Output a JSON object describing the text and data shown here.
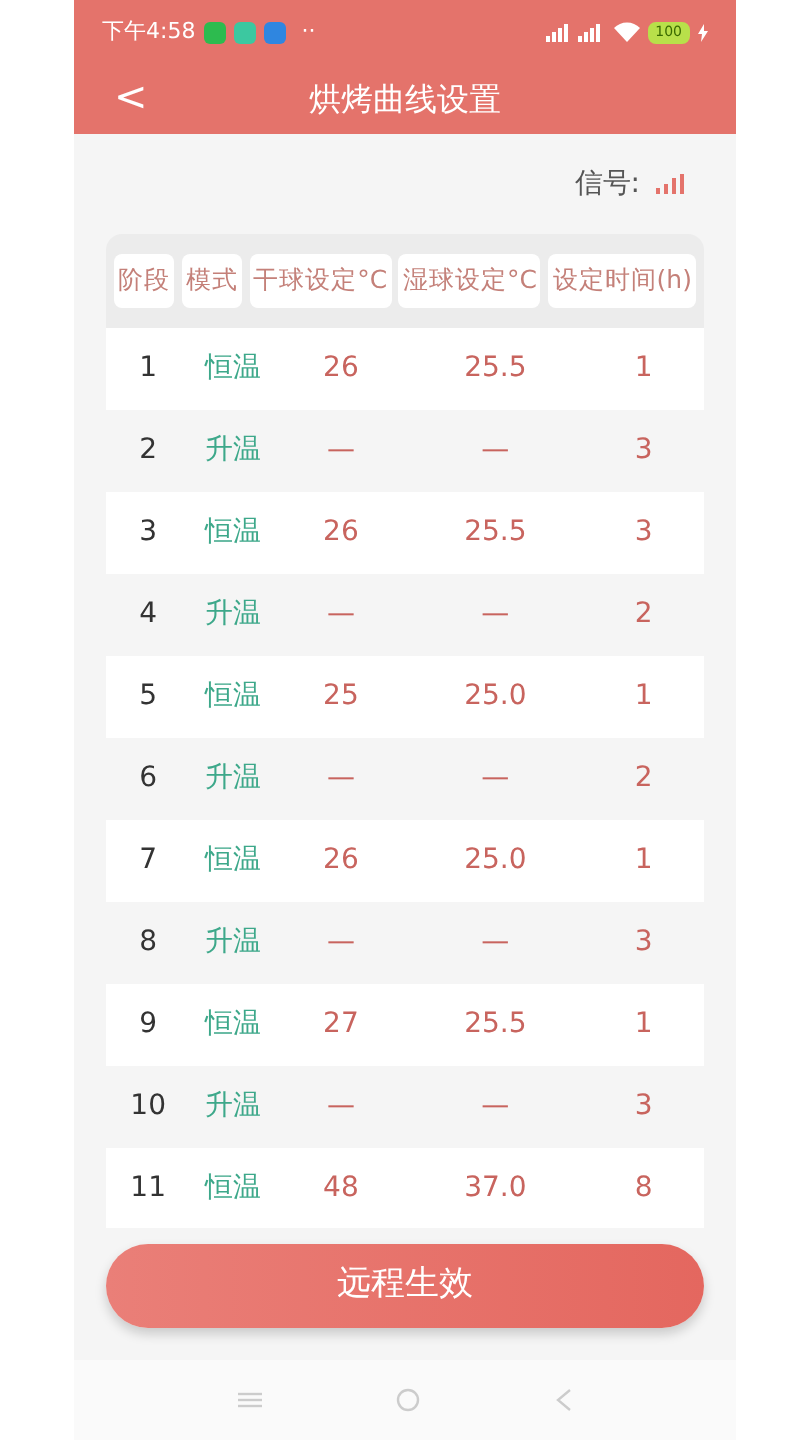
{
  "status_bar": {
    "time": "下午4:58",
    "more": "··",
    "battery": "100"
  },
  "header": {
    "back": "<",
    "title": "烘烤曲线设置"
  },
  "signal": {
    "label": "信号:"
  },
  "table": {
    "columns": [
      "阶段",
      "模式",
      "干球设定°C",
      "湿球设定°C",
      "设定时间(h)"
    ],
    "rows": [
      {
        "cells": [
          "1",
          "恒温",
          "26",
          "25.5",
          "1"
        ]
      },
      {
        "cells": [
          "2",
          "升温",
          "—",
          "—",
          "3"
        ]
      },
      {
        "cells": [
          "3",
          "恒温",
          "26",
          "25.5",
          "3"
        ]
      },
      {
        "cells": [
          "4",
          "升温",
          "—",
          "—",
          "2"
        ]
      },
      {
        "cells": [
          "5",
          "恒温",
          "25",
          "25.0",
          "1"
        ]
      },
      {
        "cells": [
          "6",
          "升温",
          "—",
          "—",
          "2"
        ]
      },
      {
        "cells": [
          "7",
          "恒温",
          "26",
          "25.0",
          "1"
        ]
      },
      {
        "cells": [
          "8",
          "升温",
          "—",
          "—",
          "3"
        ]
      },
      {
        "cells": [
          "9",
          "恒温",
          "27",
          "25.5",
          "1"
        ]
      },
      {
        "cells": [
          "10",
          "升温",
          "—",
          "—",
          "3"
        ]
      },
      {
        "cells": [
          "11",
          "恒温",
          "48",
          "37.0",
          "8"
        ]
      }
    ]
  },
  "apply_button": "远程生效"
}
